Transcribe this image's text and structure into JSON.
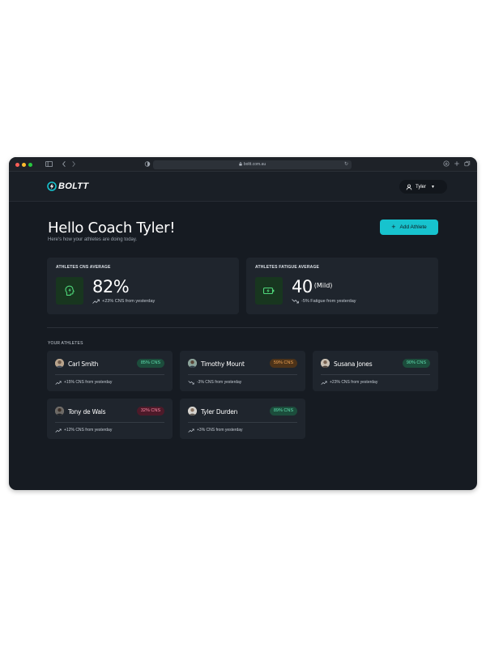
{
  "browser": {
    "url": "boltt.com.au"
  },
  "app": {
    "brand": "BOLTT",
    "user_name": "Tyler",
    "accent": "#17c3ce"
  },
  "header": {
    "greeting": "Hello Coach Tyler!",
    "subtitle": "Here's how your athletes are doing today.",
    "add_button_label": "Add Athlete"
  },
  "stats": {
    "cns": {
      "title": "ATHLETES CNS AVERAGE",
      "value": "82%",
      "trend_text": "+23% CNS from yesterday",
      "trend_direction": "up",
      "icon": "brain-bolt-icon"
    },
    "fatigue": {
      "title": "ATHLETES FATIGUE AVERAGE",
      "value": "40",
      "qualifier": "(Mild)",
      "trend_text": "-5% Fatigue from yesterday",
      "trend_direction": "down",
      "icon": "battery-bolt-icon"
    }
  },
  "athletes_section": {
    "label": "YOUR ATHLETES"
  },
  "athletes": [
    {
      "name": "Carl Smith",
      "badge": "85% CNS",
      "status": "good",
      "trend": "+15% CNS from yesterday",
      "direction": "up"
    },
    {
      "name": "Timothy Mount",
      "badge": "59% CNS",
      "status": "warn",
      "trend": "-3% CNS from yesterday",
      "direction": "down"
    },
    {
      "name": "Susana Jones",
      "badge": "90% CNS",
      "status": "good",
      "trend": "+23% CNS from yesterday",
      "direction": "up"
    },
    {
      "name": "Tony de Wals",
      "badge": "32% CNS",
      "status": "bad",
      "trend": "+12% CNS from yesterday",
      "direction": "up"
    },
    {
      "name": "Tyler Durden",
      "badge": "89% CNS",
      "status": "good",
      "trend": "+3% CNS from yesterday",
      "direction": "up"
    }
  ]
}
